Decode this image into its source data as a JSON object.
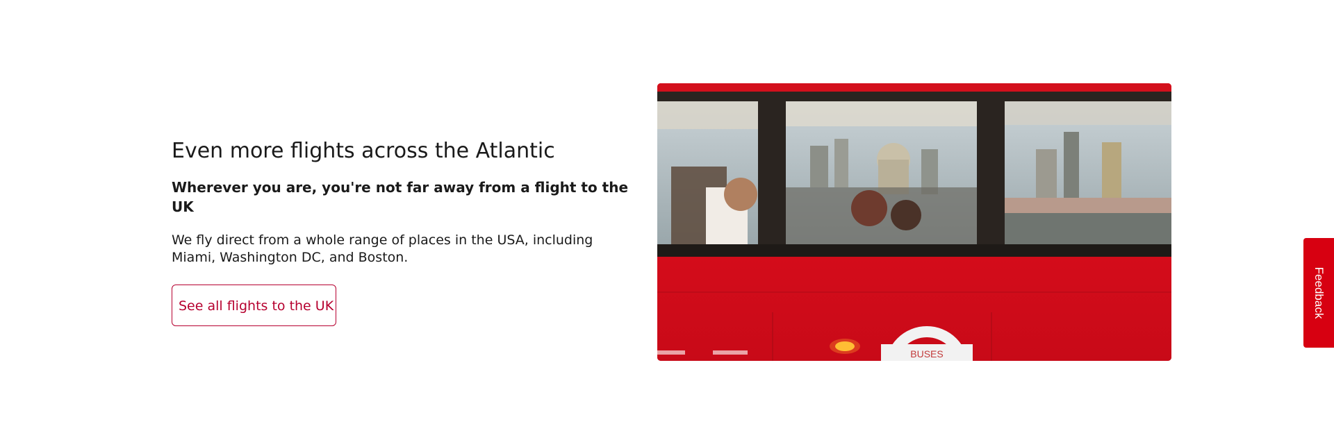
{
  "promo": {
    "headline": "Even more flights across the Atlantic",
    "subheadline": "Wherever you are, you're not far away from a flight to the UK",
    "body": "We fly direct from a whole range of places in the USA, including Miami, Washington DC, and Boston.",
    "cta_label": "See all flights to the UK"
  },
  "image": {
    "roundel_text": "BUSES"
  },
  "feedback": {
    "label": "Feedback"
  },
  "colors": {
    "brand_red": "#b6002f",
    "feedback_red": "#d70011",
    "bus_red": "#d80f1c"
  }
}
